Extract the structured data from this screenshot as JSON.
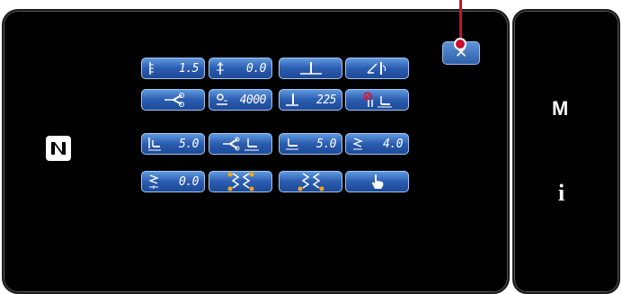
{
  "close_button": {
    "label": "✕",
    "icon": "close-icon"
  },
  "nfc": {
    "icon": "nfc-icon"
  },
  "side_menu": {
    "m_label": "M",
    "info_label": "i"
  },
  "buttons": {
    "r1": [
      {
        "value": "1.5",
        "icon": "stitch-length-icon"
      },
      {
        "value": "0.0",
        "icon": "stitch-adjust-icon"
      },
      {
        "value": "",
        "icon": "needle-position-icon"
      },
      {
        "value": "",
        "icon": "presser-foot-lift-icon"
      }
    ],
    "r2": [
      {
        "value": "",
        "icon": "thread-trim-icon"
      },
      {
        "value": "4000",
        "icon": "speed-icon"
      },
      {
        "value": "225",
        "icon": "needle-height-icon"
      },
      {
        "value": "",
        "icon": "foot-no-lift-icon"
      }
    ],
    "r3": [
      {
        "value": "5.0",
        "icon": "foot-height-icon"
      },
      {
        "value": "",
        "icon": "trim-foot-icon"
      },
      {
        "value": "5.0",
        "icon": "foot-lift-height-icon"
      },
      {
        "value": "4.0",
        "icon": "stitch-width-icon"
      }
    ],
    "r4": [
      {
        "value": "0.0",
        "icon": "feed-offset-icon"
      },
      {
        "value": "",
        "icon": "zigzag-left-icon"
      },
      {
        "value": "",
        "icon": "zigzag-right-icon"
      },
      {
        "value": "",
        "icon": "hand-pointer-icon"
      }
    ]
  }
}
